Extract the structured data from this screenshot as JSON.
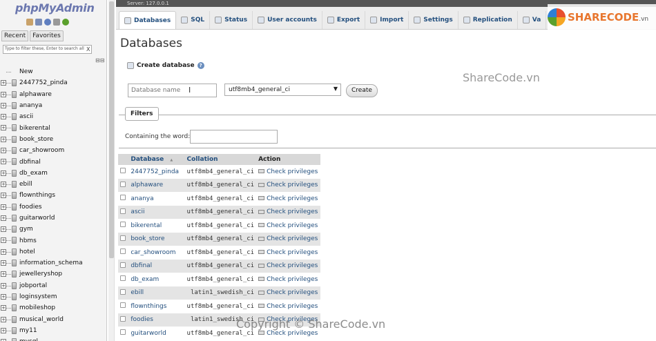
{
  "app": {
    "logo_main": "phpMyAdmin"
  },
  "nav": {
    "tabs": [
      "Recent",
      "Favorites"
    ],
    "filter_placeholder": "Type to filter these, Enter to search all",
    "filter_clear": "X",
    "collapse": "⊟⊟",
    "new_label": "New",
    "databases": [
      "2447752_pinda",
      "alphaware",
      "ananya",
      "ascii",
      "bikerental",
      "book_store",
      "car_showroom",
      "dbfinal",
      "db_exam",
      "ebill",
      "flownthings",
      "foodies",
      "guitarworld",
      "gym",
      "hbms",
      "hotel",
      "information_schema",
      "jewelleryshop",
      "jobportal",
      "loginsystem",
      "mobileshop",
      "musical_world",
      "my11",
      "mysql"
    ]
  },
  "server_bar": "Server: 127.0.0.1",
  "topnav": {
    "tabs": [
      {
        "label": "Databases",
        "icon": "database-icon",
        "active": true
      },
      {
        "label": "SQL",
        "icon": "sql-icon"
      },
      {
        "label": "Status",
        "icon": "status-icon"
      },
      {
        "label": "User accounts",
        "icon": "users-icon"
      },
      {
        "label": "Export",
        "icon": "export-icon"
      },
      {
        "label": "Import",
        "icon": "import-icon"
      },
      {
        "label": "Settings",
        "icon": "settings-icon"
      },
      {
        "label": "Replication",
        "icon": "replication-icon"
      },
      {
        "label": "Va",
        "icon": "variables-icon"
      }
    ]
  },
  "main": {
    "title": "Databases",
    "create_heading": "Create database",
    "dbname_placeholder": "Database name",
    "collation_value": "utf8mb4_general_ci",
    "create_button": "Create",
    "filters_legend": "Filters",
    "contains_label": "Containing the word:"
  },
  "table": {
    "headers": {
      "database": "Database",
      "sort_arrow": "▲",
      "collation": "Collation",
      "action": "Action"
    },
    "rows": [
      {
        "name": "2447752_pinda",
        "collation": "utf8mb4_general_ci",
        "action": "Check privileges"
      },
      {
        "name": "alphaware",
        "collation": "utf8mb4_general_ci",
        "action": "Check privileges"
      },
      {
        "name": "ananya",
        "collation": "utf8mb4_general_ci",
        "action": "Check privileges"
      },
      {
        "name": "ascii",
        "collation": "utf8mb4_general_ci",
        "action": "Check privileges"
      },
      {
        "name": "bikerental",
        "collation": "utf8mb4_general_ci",
        "action": "Check privileges"
      },
      {
        "name": "book_store",
        "collation": "utf8mb4_general_ci",
        "action": "Check privileges"
      },
      {
        "name": "car_showroom",
        "collation": "utf8mb4_general_ci",
        "action": "Check privileges"
      },
      {
        "name": "dbfinal",
        "collation": "utf8mb4_general_ci",
        "action": "Check privileges"
      },
      {
        "name": "db_exam",
        "collation": "utf8mb4_general_ci",
        "action": "Check privileges"
      },
      {
        "name": "ebill",
        "collation": "latin1_swedish_ci",
        "action": "Check privileges"
      },
      {
        "name": "flownthings",
        "collation": "utf8mb4_general_ci",
        "action": "Check privileges"
      },
      {
        "name": "foodies",
        "collation": "latin1_swedish_ci",
        "action": "Check privileges"
      },
      {
        "name": "guitarworld",
        "collation": "utf8mb4_general_ci",
        "action": "Check privileges"
      }
    ]
  },
  "watermarks": {
    "middle": "ShareCode.vn",
    "logo_text": "SHARECODE",
    "logo_sub": ".vn",
    "bottom": "Copyright © ShareCode.vn"
  },
  "colors": {
    "link": "#234f7e",
    "logo_blue": "#6c78af",
    "logo_orange": "#f29f33"
  }
}
